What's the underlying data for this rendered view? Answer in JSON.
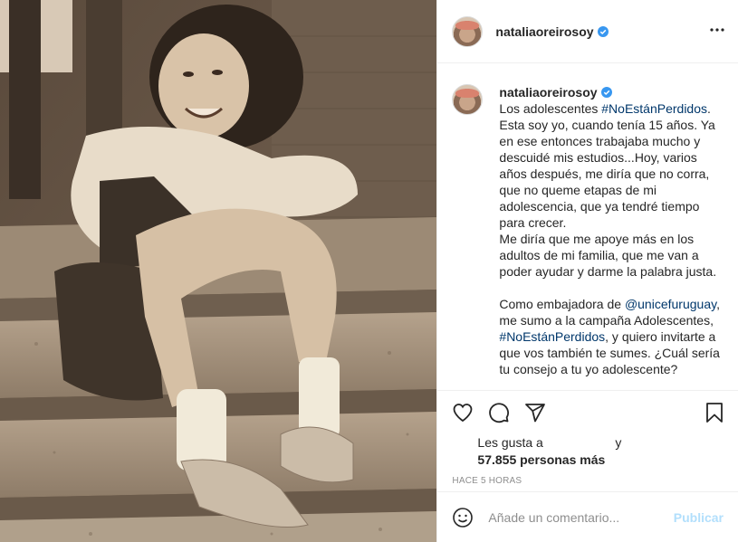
{
  "post": {
    "username": "nataliaoreirosoy",
    "verified": true,
    "more_icon": "more-horizontal-icon"
  },
  "caption": {
    "username": "nataliaoreirosoy",
    "line_intro": "Los adolescentes ",
    "hashtag1": "#NoEstánPerdidos",
    "text1": ". Esta soy yo, cuando tenía 15 años. Ya en ese entonces trabajaba mucho y descuidé mis estudios...Hoy, varios años después, me diría que no corra, que no queme etapas de mi adolescencia, que ya tendré tiempo para crecer.",
    "text2": "Me diría que me apoye más en los adultos de mi familia, que me van a poder ayudar y darme la palabra justa.",
    "text3_intro": "Como embajadora de ",
    "mention": "@unicefuruguay",
    "text3_mid": ", me sumo a la campaña Adolescentes, ",
    "hashtag2": "#NoEstánPerdidos",
    "text3_end": ", y quiero invitarte a que vos también te sumes. ¿Cuál sería tu consejo a tu yo adolescente?"
  },
  "actions": {
    "icons": [
      "heart-icon",
      "comment-icon",
      "share-icon",
      "bookmark-icon"
    ]
  },
  "likes": {
    "prefix": "Les gusta a",
    "and": "y",
    "count": "57.855 personas más"
  },
  "timestamp": "HACE 5 HORAS",
  "comment": {
    "placeholder": "Añade un comentario...",
    "publish_label": "Publicar"
  },
  "colors": {
    "link": "#00376b",
    "verified": "#3897f0",
    "publish_disabled": "#b2dffc",
    "muted": "#8e8e8e"
  }
}
